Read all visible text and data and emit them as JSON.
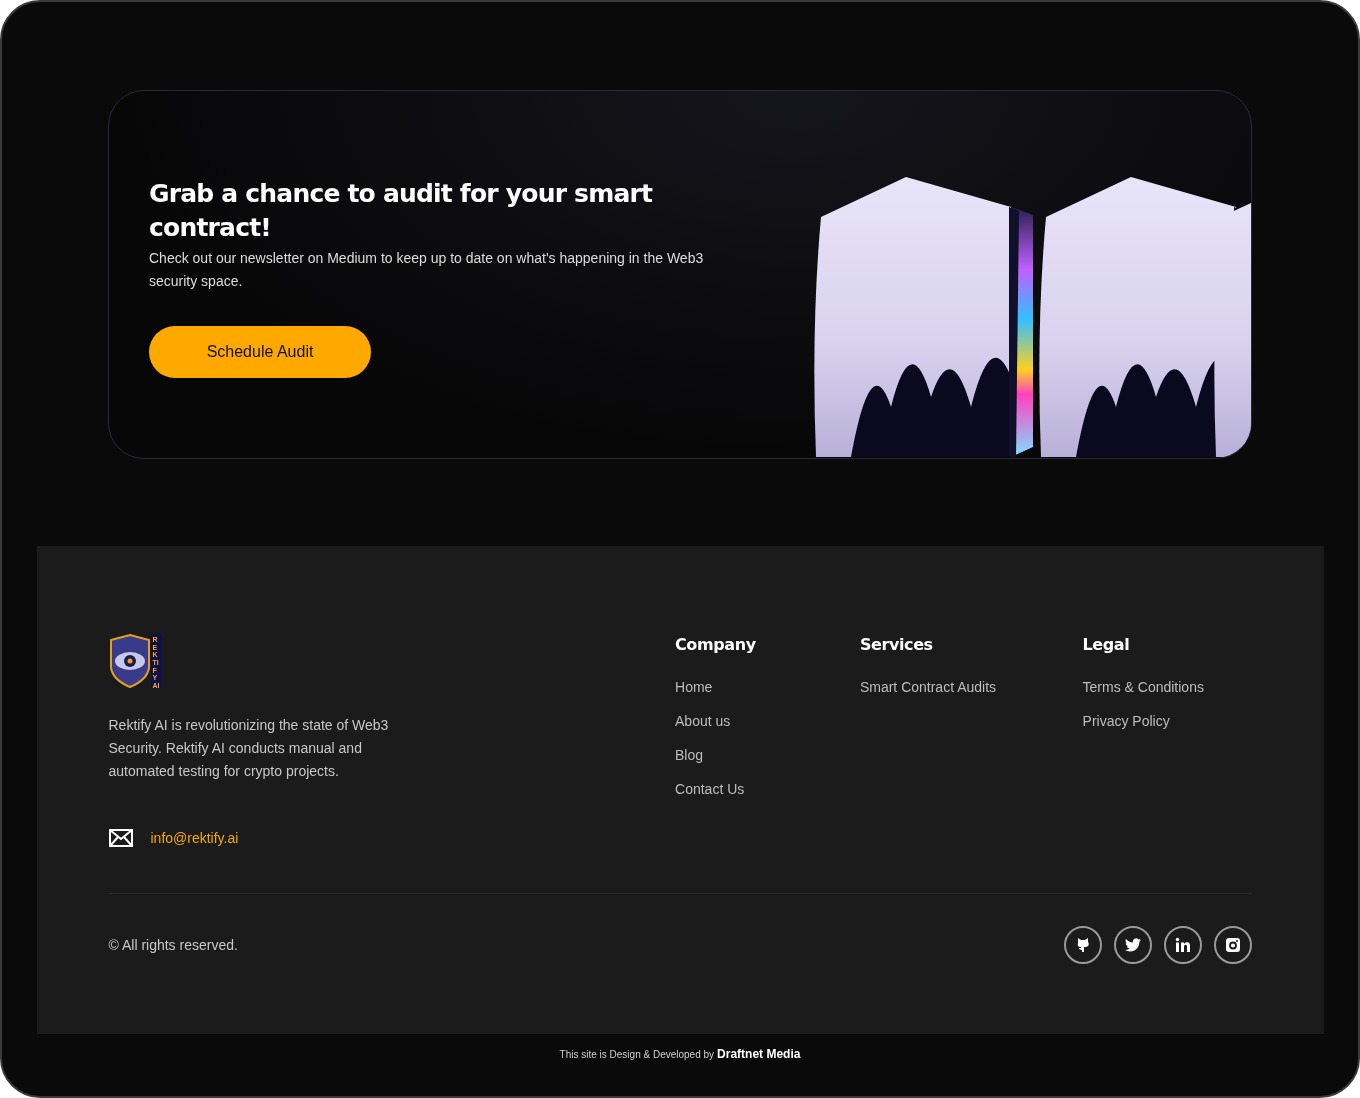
{
  "banner": {
    "title": "Grab a chance to audit for your smart contract!",
    "description": "Check out our newsletter on Medium to keep up to date on what's happening in the Web3 security space.",
    "button": "Schedule Audit"
  },
  "footer": {
    "logo_text": "REKTIFY AI",
    "about": "Rektify AI is revolutionizing the state of Web3 Security. Rektify AI conducts manual and automated testing for crypto projects.",
    "email": "info@rektify.ai",
    "columns": [
      {
        "heading": "Company",
        "links": [
          "Home",
          "About us",
          "Blog",
          "Contact Us"
        ]
      },
      {
        "heading": "Services",
        "links": [
          "Smart Contract Audits"
        ]
      },
      {
        "heading": "Legal",
        "links": [
          "Terms & Conditions",
          "Privacy Policy"
        ]
      }
    ],
    "copyright": "© All rights reserved.",
    "social": [
      {
        "kind": "github"
      },
      {
        "kind": "twitter"
      },
      {
        "kind": "linkedin"
      },
      {
        "kind": "instagram"
      }
    ]
  },
  "credit": {
    "text": "This site is Design & Developed by",
    "brand": "Draftnet Media"
  }
}
